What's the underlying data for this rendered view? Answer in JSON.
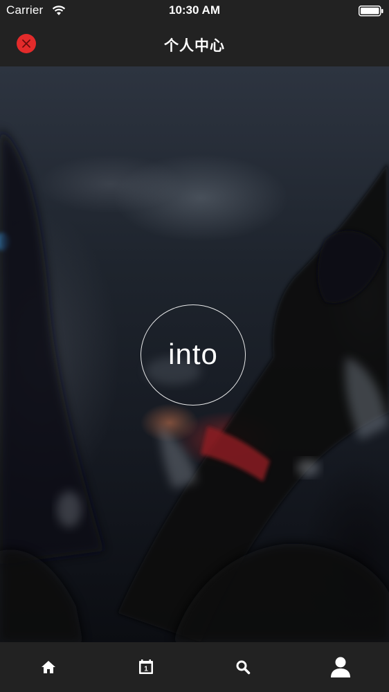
{
  "status_bar": {
    "carrier": "Carrier",
    "time": "10:30 AM",
    "wifi_icon": "wifi-icon",
    "battery_icon": "battery-icon"
  },
  "nav": {
    "title": "个人中心",
    "close_icon": "close-icon",
    "close_color": "#e32b2b",
    "background": "#222222"
  },
  "hero": {
    "button_label": "into"
  },
  "tab_bar": {
    "background": "#222222",
    "tabs": [
      {
        "icon": "home-icon"
      },
      {
        "icon": "calendar-icon",
        "day": "1"
      },
      {
        "icon": "search-icon"
      },
      {
        "icon": "profile-icon"
      }
    ]
  }
}
